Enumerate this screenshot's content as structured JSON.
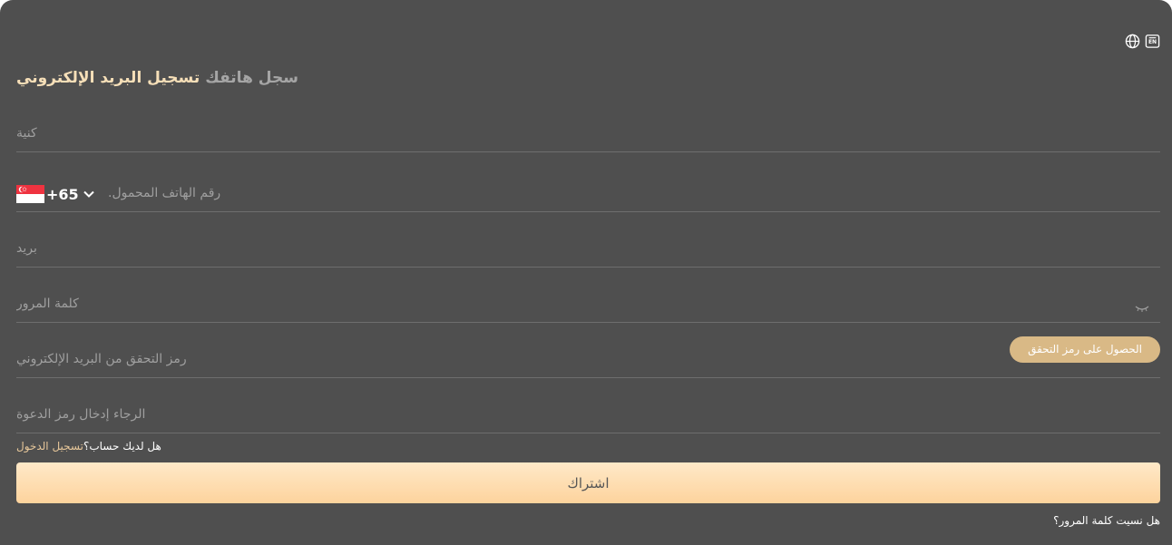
{
  "header": {
    "icons": [
      "globe-icon",
      "language-en-icon"
    ],
    "language_badge": "EN"
  },
  "tabs": [
    {
      "label": "تسجيل البريد الإلكتروني",
      "active": true
    },
    {
      "label": "سجل هاتفك",
      "active": false
    }
  ],
  "form": {
    "nickname": {
      "placeholder": "كنية",
      "value": ""
    },
    "phone": {
      "placeholder": "رقم الهاتف المحمول.",
      "value": "",
      "country_code": "+65",
      "country_flag": "singapore-flag-icon"
    },
    "email": {
      "placeholder": "بريد",
      "value": ""
    },
    "password": {
      "placeholder": "كلمة المرور",
      "value": "",
      "toggle_icon": "eye-closed-icon"
    },
    "verification_code": {
      "placeholder": "رمز التحقق من البريد الإلكتروني",
      "value": "",
      "button_label": "الحصول على رمز التحقق"
    },
    "invite_code": {
      "placeholder": "الرجاء إدخال رمز الدعوة",
      "value": ""
    }
  },
  "login_prompt": {
    "question": "هل لديك حساب؟",
    "link_label": "تسجيل الدخول"
  },
  "submit_label": "اشتراك",
  "forgot_password": "هل نسيت كلمة المرور؟",
  "colors": {
    "background": "#4f4f4f",
    "accent": "#f6dfb8",
    "button": "#d9b986",
    "submit_gradient_top": "#ffe9c8",
    "submit_gradient_bottom": "#fdd39d"
  }
}
